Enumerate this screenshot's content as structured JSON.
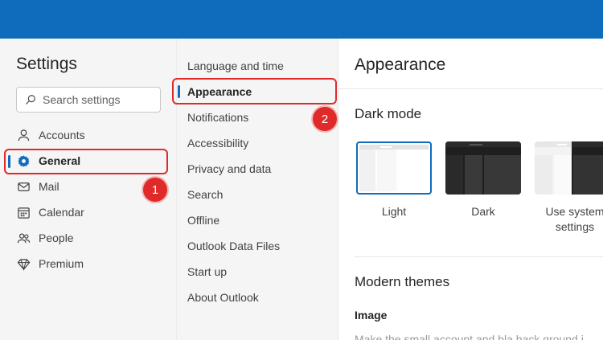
{
  "settings": {
    "title": "Settings",
    "search_placeholder": "Search settings"
  },
  "nav": {
    "items": [
      {
        "label": "Accounts",
        "icon": "person-icon",
        "active": false
      },
      {
        "label": "General",
        "icon": "gear-icon",
        "active": true
      },
      {
        "label": "Mail",
        "icon": "mail-icon",
        "active": false
      },
      {
        "label": "Calendar",
        "icon": "calendar-icon",
        "active": false
      },
      {
        "label": "People",
        "icon": "people-icon",
        "active": false
      },
      {
        "label": "Premium",
        "icon": "diamond-icon",
        "active": false
      }
    ]
  },
  "general_menu": {
    "items": [
      {
        "label": "Language and time",
        "active": false
      },
      {
        "label": "Appearance",
        "active": true
      },
      {
        "label": "Notifications",
        "active": false
      },
      {
        "label": "Accessibility",
        "active": false
      },
      {
        "label": "Privacy and data",
        "active": false
      },
      {
        "label": "Search",
        "active": false
      },
      {
        "label": "Offline",
        "active": false
      },
      {
        "label": "Outlook Data Files",
        "active": false
      },
      {
        "label": "Start up",
        "active": false
      },
      {
        "label": "About Outlook",
        "active": false
      }
    ]
  },
  "callouts": [
    "1",
    "2"
  ],
  "appearance": {
    "title": "Appearance",
    "dark_mode": {
      "title": "Dark mode",
      "options": [
        {
          "label": "Light",
          "selected": true
        },
        {
          "label": "Dark",
          "selected": false
        },
        {
          "label": "Use system settings",
          "selected": false
        }
      ]
    },
    "modern_themes": {
      "title": "Modern themes",
      "image_heading": "Image",
      "truncated_text": "Make the small account and bla back ground i"
    }
  },
  "colors": {
    "accent": "#0f6cbd",
    "callout": "#e02a2a"
  }
}
